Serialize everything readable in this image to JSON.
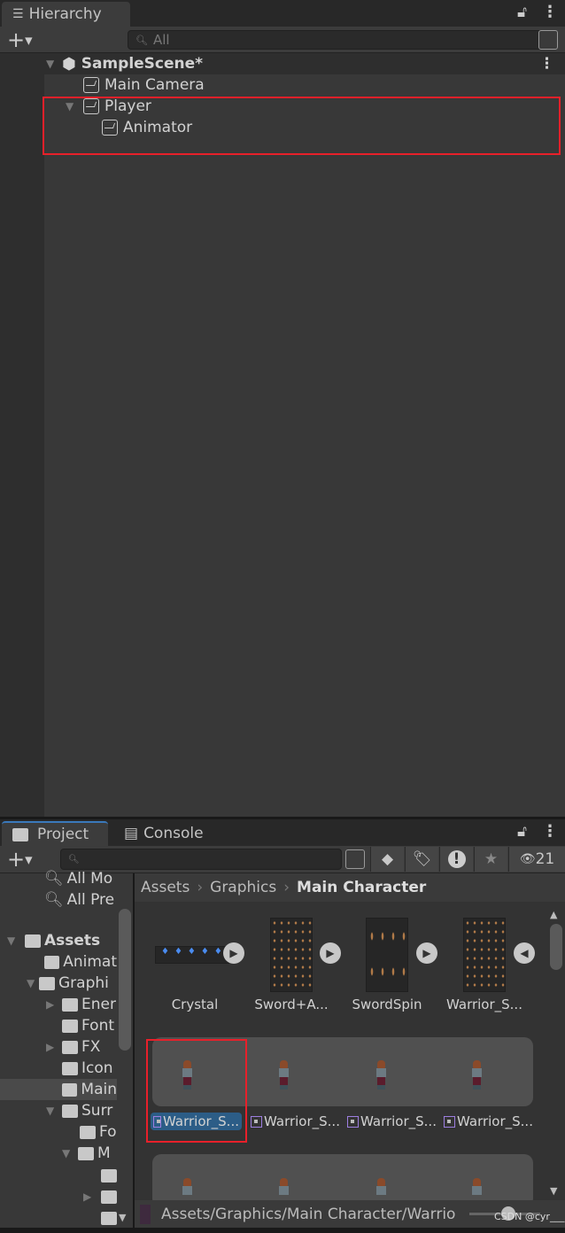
{
  "hierarchy": {
    "tab": "Hierarchy",
    "search_placeholder": "All",
    "scene": "SampleScene*",
    "items": [
      {
        "label": "Main Camera"
      },
      {
        "label": "Player"
      },
      {
        "label": "Animator"
      }
    ]
  },
  "project": {
    "tabs": [
      "Project",
      "Console"
    ],
    "hidden_count": "21",
    "favorites": [
      "All Mo",
      "All Pre"
    ],
    "tree": [
      {
        "label": "Assets"
      },
      {
        "label": "Animat"
      },
      {
        "label": "Graphi"
      },
      {
        "label": "Ener"
      },
      {
        "label": "Font"
      },
      {
        "label": "FX"
      },
      {
        "label": "Icon"
      },
      {
        "label": "Main"
      },
      {
        "label": "Surr"
      },
      {
        "label": "Fo"
      },
      {
        "label": "M"
      }
    ],
    "breadcrumb": [
      "Assets",
      "Graphics",
      "Main Character"
    ],
    "assets": [
      "Crystal",
      "Sword+A...",
      "SwordSpin",
      "Warrior_S..."
    ],
    "sprites": [
      "Warrior_S...",
      "Warrior_S...",
      "Warrior_S...",
      "Warrior_S..."
    ],
    "status_path": "Assets/Graphics/Main Character/Warrio",
    "watermark": "CSDN @cyr___"
  },
  "colors": {
    "highlight": "#e8202a",
    "selection": "#2c5d87",
    "panel": "#383838"
  }
}
